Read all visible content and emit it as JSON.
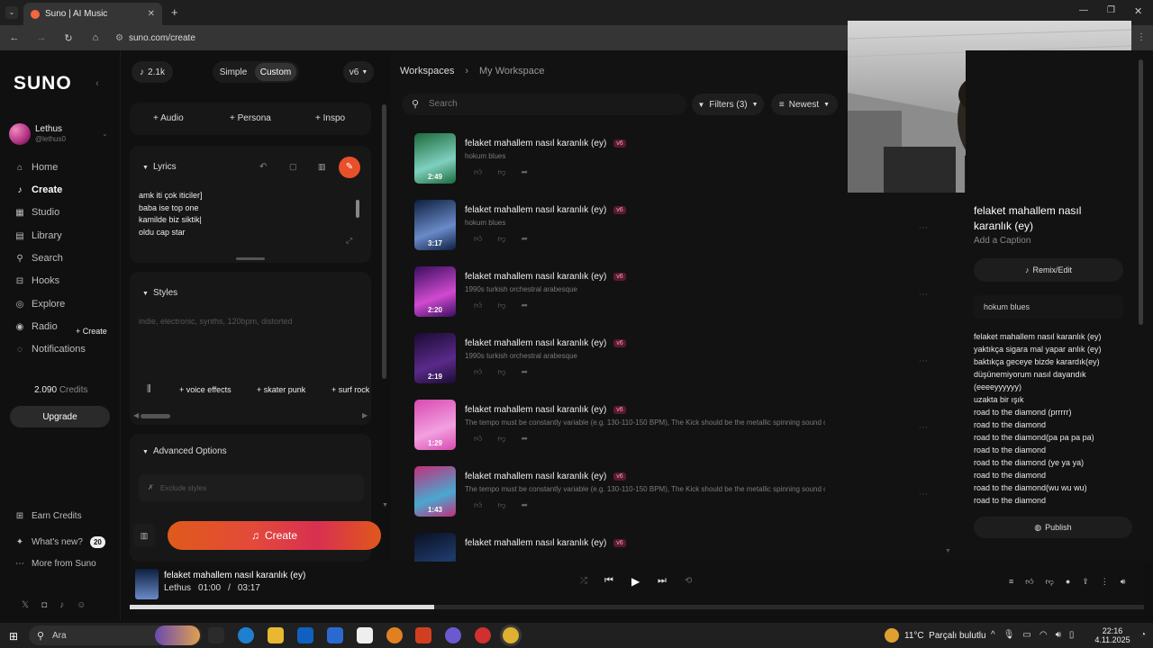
{
  "browser": {
    "tab_title": "Suno | AI Music",
    "url": "suno.com/create"
  },
  "sidebar": {
    "logo": "SUNO",
    "user_name": "Lethus",
    "user_handle": "@lethus0",
    "items": [
      {
        "label": "Home",
        "icon": "home-icon"
      },
      {
        "label": "Create",
        "icon": "music-note-icon"
      },
      {
        "label": "Studio",
        "icon": "studio-icon"
      },
      {
        "label": "Library",
        "icon": "library-icon"
      },
      {
        "label": "Search",
        "icon": "search-icon"
      },
      {
        "label": "Hooks",
        "icon": "hooks-icon"
      },
      {
        "label": "Explore",
        "icon": "compass-icon"
      },
      {
        "label": "Radio",
        "icon": "radio-icon"
      },
      {
        "label": "Notifications",
        "icon": "bell-icon"
      }
    ],
    "hooks_create": "+ Create",
    "credits_value": "2.090",
    "credits_label": "Credits",
    "upgrade": "Upgrade",
    "earn_credits": "Earn Credits",
    "whats_new": "What's new?",
    "whats_new_count": "20",
    "more_from_suno": "More from Suno"
  },
  "create": {
    "credit_count": "2.1k",
    "mode_simple": "Simple",
    "mode_custom": "Custom",
    "version": "v6",
    "btn_audio": "Audio",
    "btn_persona": "Persona",
    "btn_inspo": "Inspo",
    "lyrics_label": "Lyrics",
    "lyrics_lines": [
      "amk iti çok iticiler]",
      "baba ise top one",
      "kamilde biz siktik|",
      "oldu cap star"
    ],
    "styles_label": "Styles",
    "styles_placeholder": "indie, electronic, synths, 120bpm, distorted",
    "tag_voice": "voice effects",
    "tag_skater": "skater punk",
    "tag_surf": "surf rock",
    "advanced_label": "Advanced Options",
    "exclude_placeholder": "Exclude styles",
    "create_button": "Create"
  },
  "workspace": {
    "crumb_workspaces": "Workspaces",
    "crumb_my": "My Workspace",
    "search_placeholder": "Search",
    "filters": "Filters (3)",
    "sort": "Newest",
    "songs": [
      {
        "title": "felaket mahallem nasıl karanlık (ey)",
        "badge": "v6",
        "style": "hokum blues",
        "duration": "2:49",
        "c1": "#1d6a3a",
        "c2": "#7fd0c0"
      },
      {
        "title": "felaket mahallem nasıl karanlık (ey)",
        "badge": "v6",
        "style": "hokum blues",
        "duration": "3:17",
        "c1": "#0d1f3f",
        "c2": "#6a8ac8"
      },
      {
        "title": "felaket mahallem nasıl karanlık (ey)",
        "badge": "v6",
        "style": "1990s turkish orchestral arabesque",
        "duration": "2:20",
        "c1": "#3a0e5f",
        "c2": "#d04ad0"
      },
      {
        "title": "felaket mahallem nasıl karanlık (ey)",
        "badge": "v6",
        "style": "1990s turkish orchestral arabesque",
        "duration": "2:19",
        "c1": "#1a0b33",
        "c2": "#5a2a8a"
      },
      {
        "title": "felaket mahallem nasıl karanlık (ey)",
        "badge": "v6",
        "style": "The tempo must be constantly variable (e.g. 130-110-150 BPM), The Kick should be the metallic spinning sound of a ...",
        "duration": "1:29",
        "c1": "#d84ab0",
        "c2": "#f2a0e0"
      },
      {
        "title": "felaket mahallem nasıl karanlık (ey)",
        "badge": "v6",
        "style": "The tempo must be constantly variable (e.g. 130-110-150 BPM), The Kick should be the metallic spinning sound of a ...",
        "duration": "1:43",
        "c1": "#c0307a",
        "c2": "#4aa8d0"
      },
      {
        "title": "felaket mahallem nasıl karanlık (ey)",
        "badge": "v6",
        "style": "",
        "duration": "",
        "c1": "#0a1022",
        "c2": "#1e3a6a"
      }
    ]
  },
  "detail": {
    "title": "felaket mahallem nasıl karanlık (ey)",
    "add_caption": "Add a Caption",
    "remix": "Remix/Edit",
    "style": "hokum blues",
    "lyrics": [
      "felaket mahallem nasıl karanlık (ey)",
      "yaktıkça sigara mal yapar anlık (ey)",
      "baktıkça geceye bizde karardık(ey)",
      "düşünemiyorum nasıl dayandık",
      "(eeeeyyyyyy)",
      "uzakta bir ışık",
      "road to the diamond (prrrrr)",
      "road to the diamond",
      "road to the diamond(pa pa pa pa)",
      "road to the diamond",
      "road to the diamond (ye ya ya)",
      "road to the diamond",
      "road to the diamond(wu wu wu)",
      "road to the diamond"
    ],
    "publish": "Publish"
  },
  "player": {
    "title": "felaket mahallem nasıl karanlık (ey)",
    "artist": "Lethus",
    "time_current": "01:00",
    "time_sep": "/",
    "time_total": "03:17",
    "progress": 0.3
  },
  "taskbar": {
    "search": "Ara",
    "weather": "11°C  Parçalı bulutlu",
    "time": "22:16",
    "date": "4.11.2025"
  }
}
